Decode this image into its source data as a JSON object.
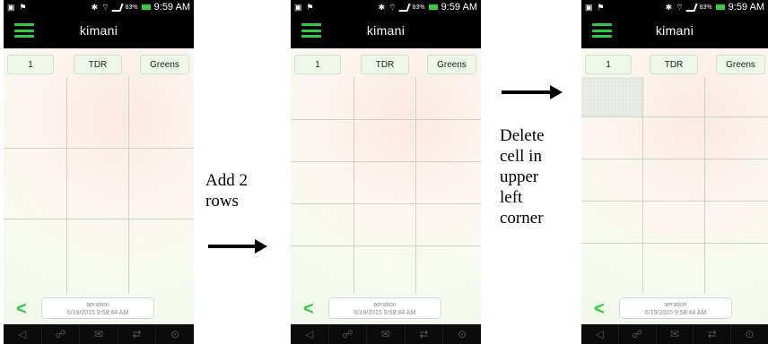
{
  "status_bar": {
    "time": "9:59 AM",
    "battery": "83%"
  },
  "app": {
    "title": "kimani"
  },
  "tabs": [
    "1",
    "TDR",
    "Greens"
  ],
  "footer": {
    "label": "aeration",
    "timestamp": "6/19/2015 9:58:44 AM"
  },
  "nav_icons": [
    "speaker-icon",
    "satellite-icon",
    "mail-icon",
    "transfer-icon",
    "location-pin-icon"
  ],
  "captions": {
    "add_rows": [
      "Add 2",
      "rows"
    ],
    "delete_cell": [
      "Delete",
      "cell in",
      "upper",
      "left",
      "corner"
    ]
  }
}
